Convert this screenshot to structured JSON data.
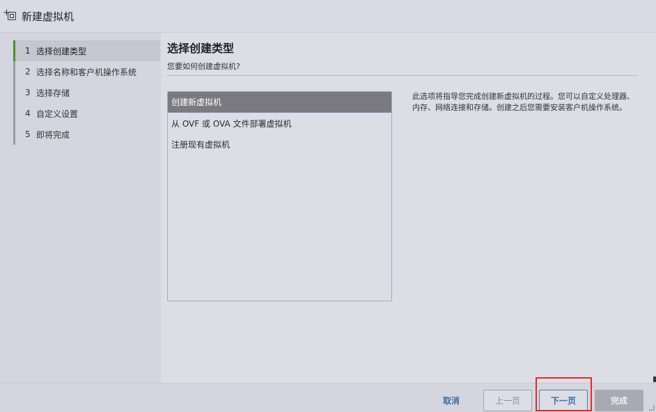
{
  "window": {
    "title": "新建虚拟机"
  },
  "steps": [
    {
      "num": "1",
      "label": "选择创建类型",
      "active": true
    },
    {
      "num": "2",
      "label": "选择名称和客户机操作系统",
      "active": false
    },
    {
      "num": "3",
      "label": "选择存储",
      "active": false
    },
    {
      "num": "4",
      "label": "自定义设置",
      "active": false
    },
    {
      "num": "5",
      "label": "即将完成",
      "active": false
    }
  ],
  "main": {
    "title": "选择创建类型",
    "subtitle": "您要如何创建虚拟机?",
    "types": [
      {
        "label": "创建新虚拟机",
        "selected": true
      },
      {
        "label": "从 OVF 或 OVA 文件部署虚拟机",
        "selected": false
      },
      {
        "label": "注册现有虚拟机",
        "selected": false
      }
    ],
    "description": "此选项将指导您完成创建新虚拟机的过程。您可以自定义处理器、内存、网络连接和存储。创建之后您需要安装客户机操作系统。"
  },
  "footer": {
    "cancel_label": "取消",
    "prev_label": "上一页",
    "next_label": "下一页",
    "finish_label": "完成"
  },
  "colors": {
    "accent_active_step": "#4e8f2a",
    "selection_bg": "#7a7a80",
    "link_blue": "#3b6ea5",
    "highlight_red": "#e02b2b"
  }
}
